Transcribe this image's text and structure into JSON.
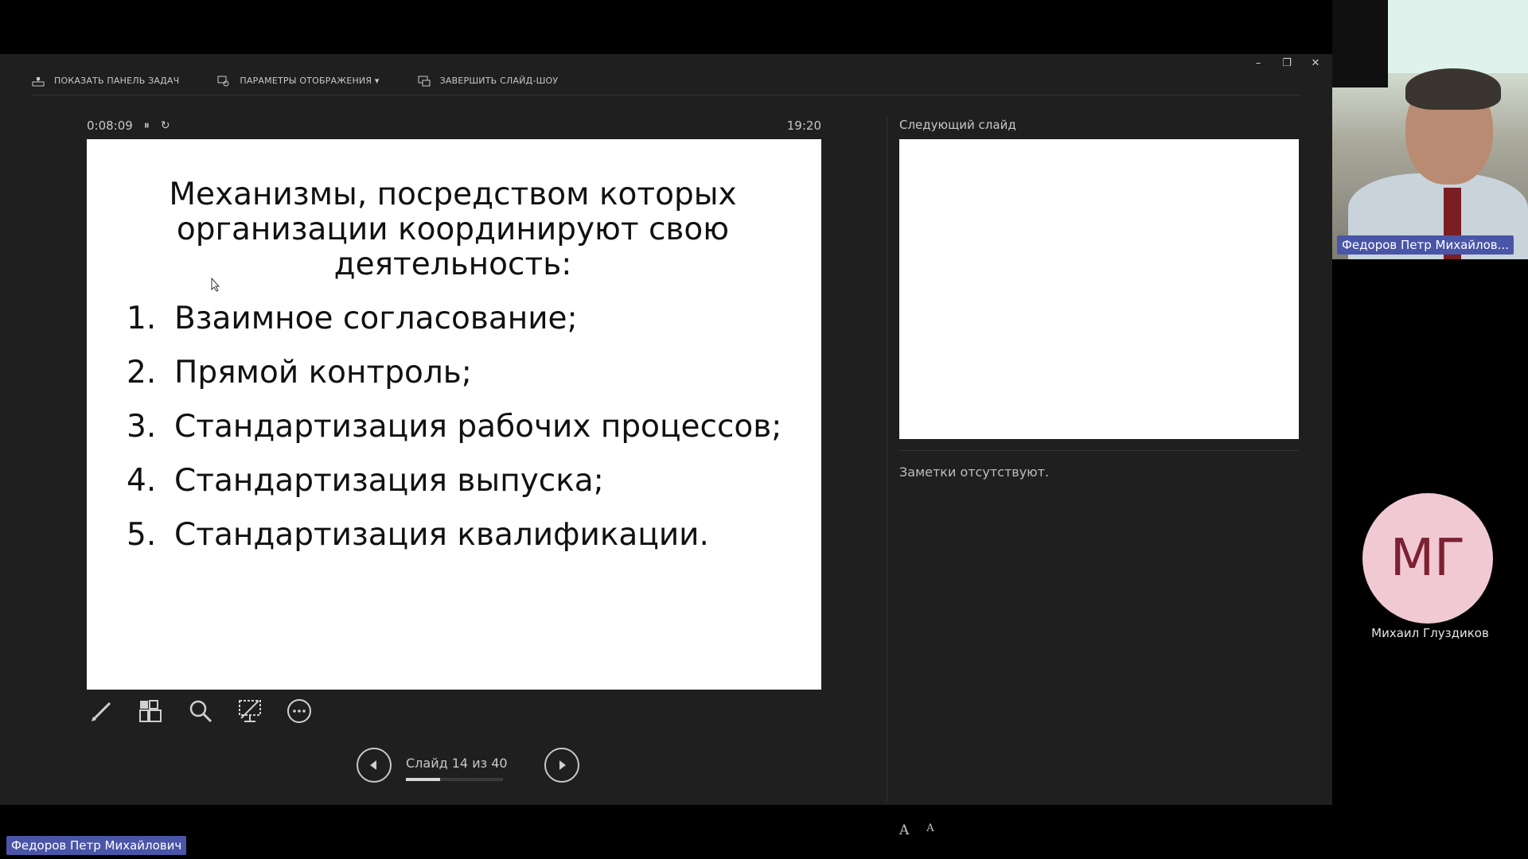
{
  "toolbar": {
    "show_taskbar": "ПОКАЗАТЬ ПАНЕЛЬ ЗАДАЧ",
    "display_settings": "ПАРАМЕТРЫ ОТОБРАЖЕНИЯ ▾",
    "end_slideshow": "ЗАВЕРШИТЬ СЛАЙД-ШОУ"
  },
  "window_controls": {
    "minimize": "–",
    "restore": "❐",
    "close": "✕"
  },
  "timer": {
    "elapsed": "0:08:09",
    "pause": "⏸",
    "reset": "↻",
    "clock": "19:20"
  },
  "slide": {
    "title": "Механизмы, посредством которых организации координируют свою деятельность:",
    "items": [
      {
        "num": "1.",
        "text": "Взаимное согласование;"
      },
      {
        "num": "2.",
        "text": "Прямой контроль;"
      },
      {
        "num": "3.",
        "text": "Стандартизация рабочих процессов;"
      },
      {
        "num": "4.",
        "text": "Стандартизация выпуска;"
      },
      {
        "num": "5.",
        "text": "Стандартизация квалификации."
      }
    ]
  },
  "next_slide": {
    "label": "Следующий слайд"
  },
  "notes": {
    "text": "Заметки отсутствуют."
  },
  "tools": [
    "pen-icon",
    "slides-grid-icon",
    "zoom-icon",
    "presenter-screen-icon",
    "more-icon"
  ],
  "navigation": {
    "slide_info": "Слайд 14 из 40",
    "current": 14,
    "total": 40
  },
  "font_controls": {
    "increase": "A",
    "decrease": "A"
  },
  "video": {
    "name": "Федоров Петр Михайлов..."
  },
  "participant": {
    "initials": "МГ",
    "name": "Михаил Глуздиков"
  },
  "bottom_label": {
    "name": "Федоров Петр Михайлович"
  },
  "colors": {
    "window_bg": "#1f1f1f",
    "accent_label": "#4a55a8",
    "avatar_bg": "#f1c9d3",
    "avatar_text": "#7b2133"
  }
}
